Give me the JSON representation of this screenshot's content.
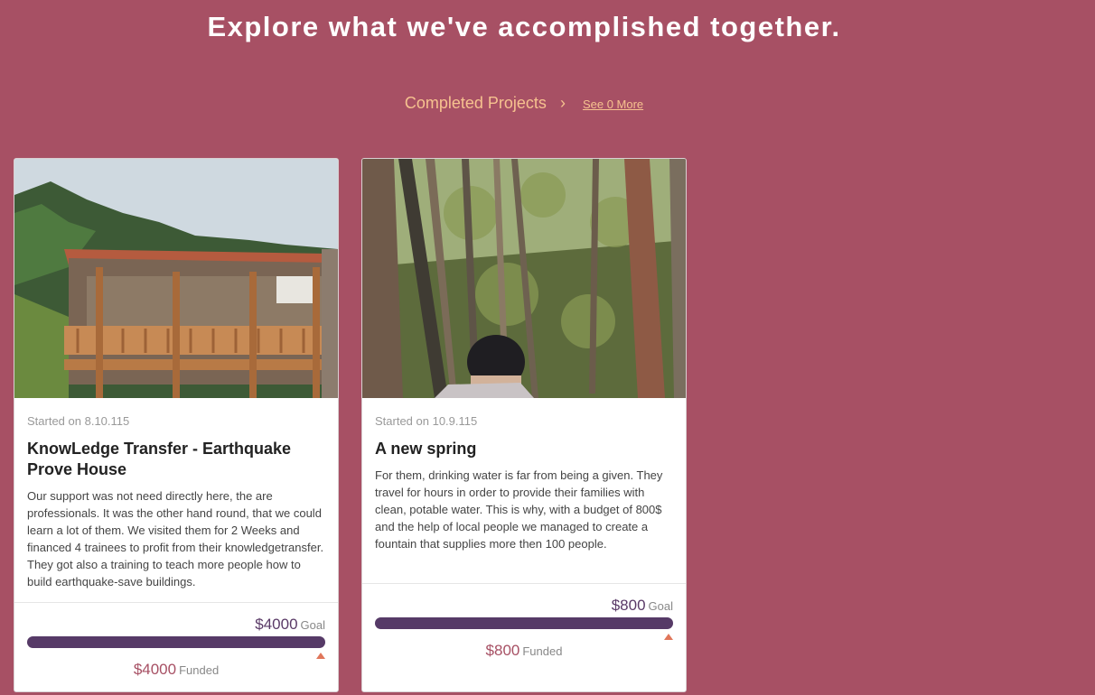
{
  "hero": {
    "title": "Explore what we've accomplished together."
  },
  "section": {
    "label": "Completed Projects",
    "chevron_icon": "chevron-right-icon",
    "see_more": "See 0 More"
  },
  "colors": {
    "background": "#a75064",
    "accent": "#f6c28f",
    "progress": "#563a67",
    "marker": "#e0765a"
  },
  "projects": [
    {
      "image": "wooden-house-photo",
      "started": "Started on 8.10.115",
      "title": "KnowLedge Transfer - Earthquake Prove House",
      "description": "Our support was not need directly here, the are professionals. It was the other hand round, that we could learn a lot of them. We visited them for 2 Weeks and financed 4 trainees to profit from their knowledgetransfer. They got also a training to teach more people how to build earthquake-save buildings.",
      "goal_amount": "$4000",
      "goal_label": "Goal",
      "funded_amount": "$4000",
      "funded_label": "Funded",
      "progress": 1.0
    },
    {
      "image": "forest-spring-photo",
      "started": "Started on 10.9.115",
      "title": "A new spring",
      "description": "For them, drinking water is far from being a given. They travel for hours in order to provide their families with clean, potable water. This is why, with a budget of 800$ and the help of local people we managed to create a fountain that supplies more then 100 people.",
      "goal_amount": "$800",
      "goal_label": "Goal",
      "funded_amount": "$800",
      "funded_label": "Funded",
      "progress": 1.0
    }
  ]
}
